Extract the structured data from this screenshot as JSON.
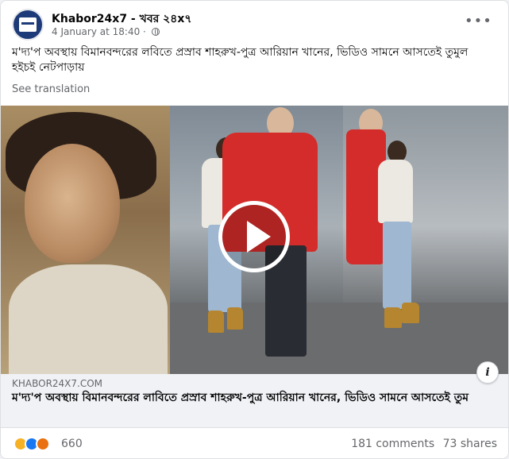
{
  "post": {
    "page_name": "Khabor24x7 - খবর ২৪x৭",
    "date": "4 January at 18:40",
    "separator": "·",
    "text": "ম'দ্য'প অবস্থায় বিমানবন্দরের লবিতে প্রস্রাব শাহরুখ-পুত্র আরিয়ান খানের, ভিডিও সামনে আসতেই তুমুল হইচই নেটপাড়ায়",
    "see_translation": "See translation",
    "more_icon": "more-horizontal-icon",
    "avatar_logo_text": "খবর 24x7"
  },
  "media": {
    "play_icon": "play-icon",
    "info_icon_glyph": "i"
  },
  "link_preview": {
    "domain": "KHABOR24X7.COM",
    "title": "ম'দ্য'প অবস্থায় বিমানবন্দরের লাবিতে প্রস্রাব শাহরুখ-পুত্র আরিয়ান খানের, ভিডিও সামনে আসতেই তুম"
  },
  "footer": {
    "reaction_icons": [
      "haha-reaction-icon",
      "like-reaction-icon",
      "angry-reaction-icon"
    ],
    "reaction_count": "660",
    "comments": "181 comments",
    "shares": "73 shares"
  },
  "colors": {
    "brand_blue": "#1877f2",
    "secondary_text": "#65676b",
    "jacket_red": "#d32c2a"
  }
}
